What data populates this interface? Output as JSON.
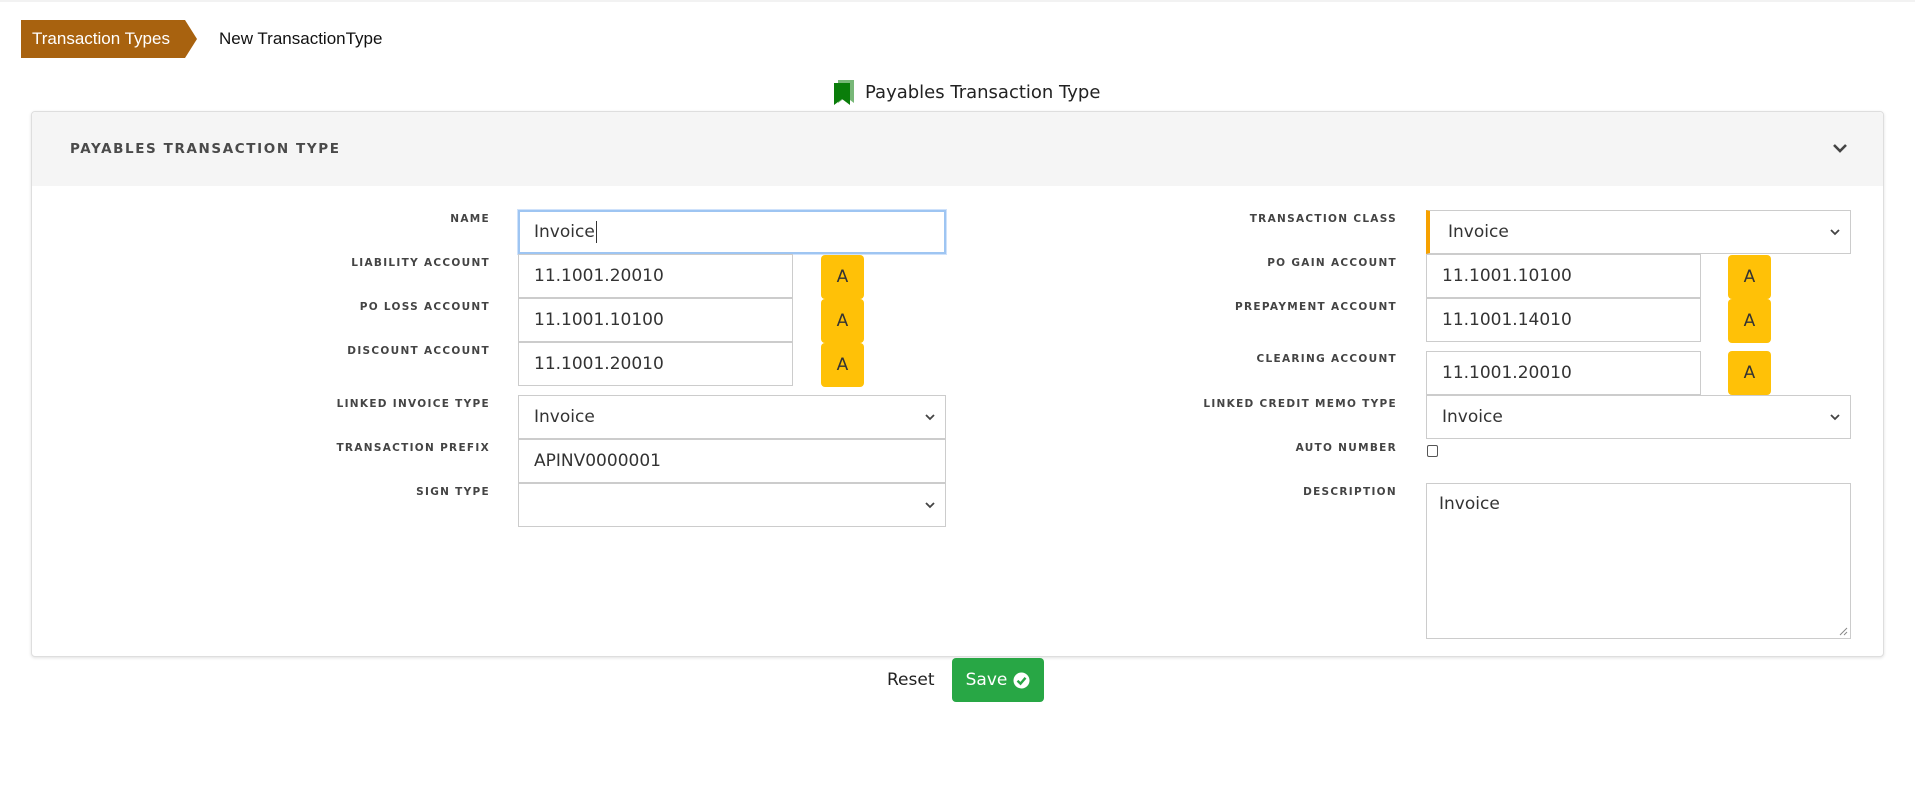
{
  "breadcrumb": {
    "parent": "Transaction Types",
    "current": "New TransactionType"
  },
  "page_title": {
    "icon": "bookmark-icon",
    "text": "Payables Transaction Type",
    "icon_color": "#0a7d0a"
  },
  "card": {
    "title": "PAYABLES TRANSACTION TYPE",
    "collapse_icon": "chevron-down-icon"
  },
  "left": {
    "name": {
      "label": "NAME",
      "value": "Invoice"
    },
    "liability_account": {
      "label": "LIABILITY ACCOUNT",
      "value": "11.1001.20010",
      "button": "A"
    },
    "po_loss_account": {
      "label": "PO LOSS ACCOUNT",
      "value": "11.1001.10100",
      "button": "A"
    },
    "discount_account": {
      "label": "DISCOUNT ACCOUNT",
      "value": "11.1001.20010",
      "button": "A"
    },
    "linked_invoice_type": {
      "label": "LINKED INVOICE TYPE",
      "value": "Invoice"
    },
    "transaction_prefix": {
      "label": "TRANSACTION PREFIX",
      "value": "APINV0000001"
    },
    "sign_type": {
      "label": "SIGN TYPE",
      "value": ""
    }
  },
  "right": {
    "transaction_class": {
      "label": "TRANSACTION CLASS",
      "value": "Invoice"
    },
    "po_gain_account": {
      "label": "PO GAIN ACCOUNT",
      "value": "11.1001.10100",
      "button": "A"
    },
    "prepayment_account": {
      "label": "PREPAYMENT ACCOUNT",
      "value": "11.1001.14010",
      "button": "A"
    },
    "clearing_account": {
      "label": "CLEARING ACCOUNT",
      "value": "11.1001.20010",
      "button": "A"
    },
    "linked_credit_memo_type": {
      "label": "LINKED CREDIT MEMO TYPE",
      "value": "Invoice"
    },
    "auto_number": {
      "label": "AUTO NUMBER",
      "checked": false
    },
    "description": {
      "label": "DESCRIPTION",
      "value": "Invoice"
    }
  },
  "actions": {
    "reset": "Reset",
    "save": "Save",
    "save_icon": "check-circle-icon"
  },
  "colors": {
    "breadcrumb": "#a8620f",
    "account_button": "#ffc107",
    "save_button": "#28a745",
    "required_marker": "#f6a100"
  }
}
